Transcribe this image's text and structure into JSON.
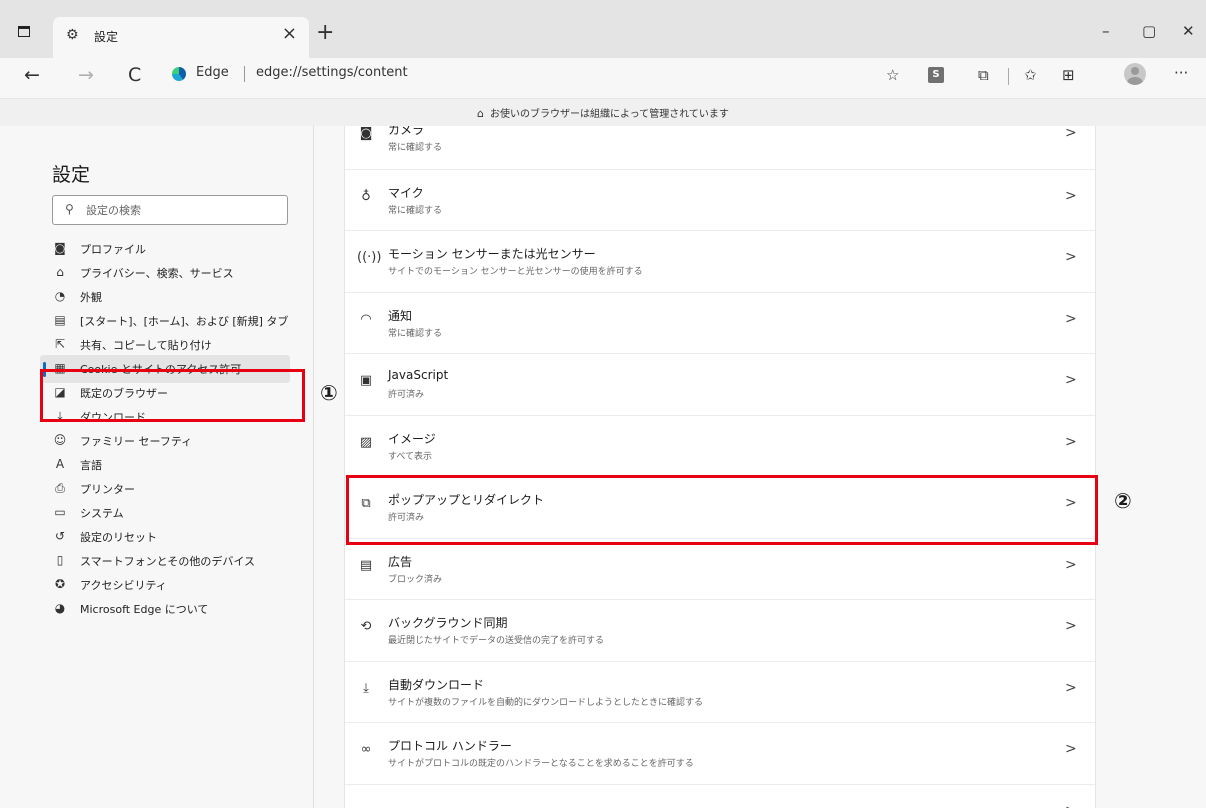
{
  "browser": {
    "tab_title": "設定",
    "tab_close": "×",
    "new_tab": "+",
    "window_controls": {
      "minimize": "–",
      "maximize": "▢",
      "close": "✕"
    },
    "address": {
      "label": "Edge",
      "url": "edge://settings/content"
    },
    "toolbar": {
      "site_badge": "S",
      "more": "···"
    },
    "nav": {
      "back": "←",
      "forward": "→",
      "refresh": "C"
    },
    "icons": {
      "tab_settings": "gear-icon",
      "favorite_add": "star-plus-icon",
      "extensions": "puzzle-icon",
      "favorites": "favorites-icon",
      "collections": "collections-icon",
      "profile": "profile-icon"
    },
    "accent_color": "#0f6cbd"
  },
  "banner": {
    "text": "お使いのブラウザーは組織によって管理されています",
    "icon": "building-icon"
  },
  "sidebar": {
    "title": "設定",
    "search_placeholder": "設定の検索",
    "items": [
      {
        "label": "プロファイル",
        "icon": "profile-icon",
        "glyph": "◙"
      },
      {
        "label": "プライバシー、検索、サービス",
        "icon": "lock-icon",
        "glyph": "⌂"
      },
      {
        "label": "外観",
        "icon": "palette-icon",
        "glyph": "◔"
      },
      {
        "label": "[スタート]、[ホーム]、および [新規] タブ",
        "icon": "home-tab-icon",
        "glyph": "▤"
      },
      {
        "label": "共有、コピーして貼り付け",
        "icon": "share-icon",
        "glyph": "⇱"
      },
      {
        "label": "Cookie とサイトのアクセス許可",
        "icon": "cookie-permissions-icon",
        "glyph": "▦",
        "active": true
      },
      {
        "label": "既定のブラウザー",
        "icon": "default-browser-icon",
        "glyph": "◪"
      },
      {
        "label": "ダウンロード",
        "icon": "download-icon",
        "glyph": "⤓"
      },
      {
        "label": "ファミリー セーフティ",
        "icon": "family-icon",
        "glyph": "☺"
      },
      {
        "label": "言語",
        "icon": "language-icon",
        "glyph": "A"
      },
      {
        "label": "プリンター",
        "icon": "printer-icon",
        "glyph": "⎙"
      },
      {
        "label": "システム",
        "icon": "system-icon",
        "glyph": "▭"
      },
      {
        "label": "設定のリセット",
        "icon": "reset-icon",
        "glyph": "↺"
      },
      {
        "label": "スマートフォンとその他のデバイス",
        "icon": "phone-icon",
        "glyph": "▯"
      },
      {
        "label": "アクセシビリティ",
        "icon": "accessibility-icon",
        "glyph": "✪"
      },
      {
        "label": "Microsoft Edge について",
        "icon": "edge-logo-icon",
        "glyph": "◕"
      }
    ]
  },
  "content": {
    "rows": [
      {
        "title": "カメラ",
        "subtitle": "常に確認する",
        "icon": "camera-icon",
        "glyph": "◙"
      },
      {
        "title": "マイク",
        "subtitle": "常に確認する",
        "icon": "microphone-icon",
        "glyph": "♁"
      },
      {
        "title": "モーション センサーまたは光センサー",
        "subtitle": "サイトでのモーション センサーと光センサーの使用を許可する",
        "icon": "sensor-icon",
        "glyph": "((·))"
      },
      {
        "title": "通知",
        "subtitle": "常に確認する",
        "icon": "bell-icon",
        "glyph": "◠"
      },
      {
        "title": "JavaScript",
        "subtitle": "許可済み",
        "icon": "javascript-icon",
        "glyph": "▣"
      },
      {
        "title": "イメージ",
        "subtitle": "すべて表示",
        "icon": "image-icon",
        "glyph": "▨"
      },
      {
        "title": "ポップアップとリダイレクト",
        "subtitle": "許可済み",
        "icon": "popup-icon",
        "glyph": "⧉"
      },
      {
        "title": "広告",
        "subtitle": "ブロック済み",
        "icon": "ads-icon",
        "glyph": "▤"
      },
      {
        "title": "バックグラウンド同期",
        "subtitle": "最近閉じたサイトでデータの送受信の完了を許可する",
        "icon": "sync-icon",
        "glyph": "⟲"
      },
      {
        "title": "自動ダウンロード",
        "subtitle": "サイトが複数のファイルを自動的にダウンロードしようとしたときに確認する",
        "icon": "download-icon",
        "glyph": "⤓"
      },
      {
        "title": "プロトコル ハンドラー",
        "subtitle": "サイトがプロトコルの既定のハンドラーとなることを求めることを許可する",
        "icon": "protocol-icon",
        "glyph": "∞"
      },
      {
        "title": "",
        "subtitle": "",
        "icon": "midi-icon",
        "glyph": ""
      }
    ],
    "chevron": ">"
  },
  "annotations": [
    {
      "label": "①",
      "color": "#e60012"
    },
    {
      "label": "②",
      "color": "#e60012"
    }
  ]
}
